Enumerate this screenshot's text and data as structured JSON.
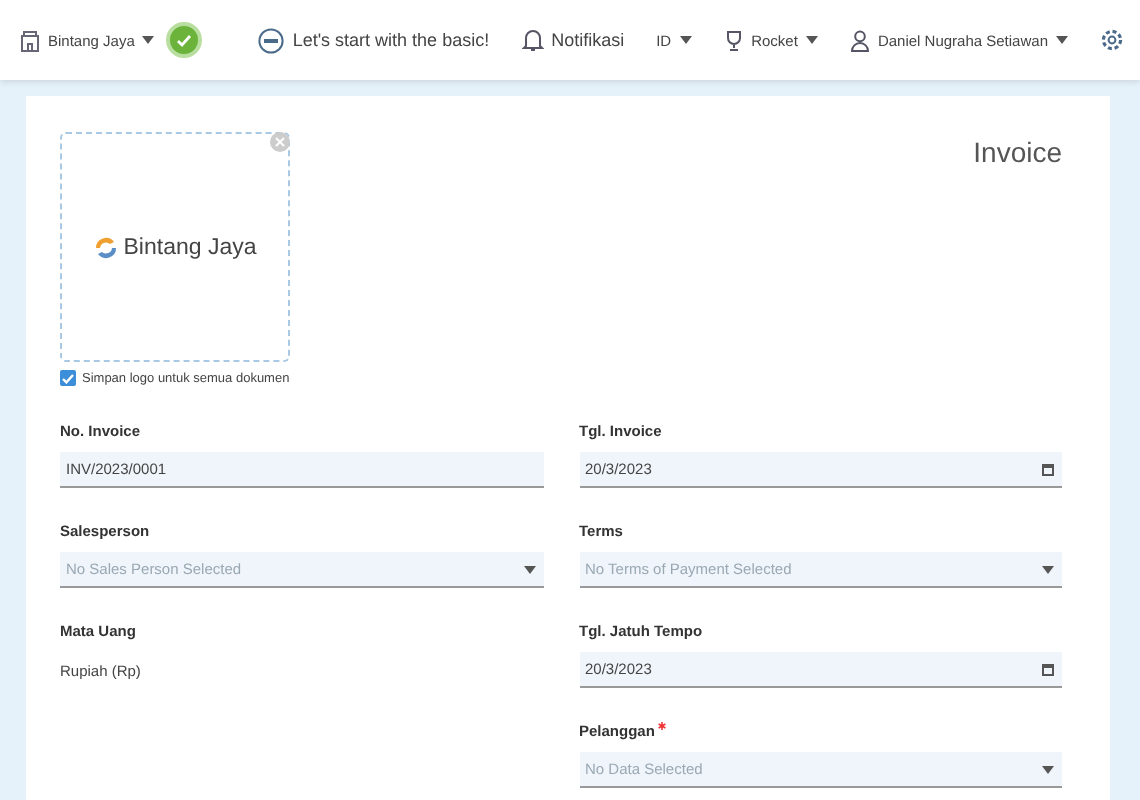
{
  "topbar": {
    "company": "Bintang Jaya",
    "verified": true,
    "guide": "Let's start with the basic!",
    "notifications": "Notifikasi",
    "language": "ID",
    "plan": "Rocket",
    "user": "Daniel Nugraha Setiawan"
  },
  "document": {
    "title": "Invoice",
    "logo_text": "Bintang Jaya",
    "save_logo": {
      "label": "Simpan logo untuk semua dokumen",
      "checked": true
    }
  },
  "left_fields": [
    {
      "kind": "text",
      "label": "No. Invoice",
      "value": "INV/2023/0001",
      "required": false
    },
    {
      "kind": "select",
      "label": "Salesperson",
      "placeholder": "No Sales Person Selected",
      "required": false
    },
    {
      "kind": "static",
      "label": "Mata Uang",
      "value": "Rupiah (Rp)",
      "required": false
    }
  ],
  "right_fields": [
    {
      "kind": "date",
      "label": "Tgl. Invoice",
      "value": "20/3/2023",
      "required": false
    },
    {
      "kind": "select",
      "label": "Terms",
      "placeholder": "No Terms of Payment Selected",
      "required": false
    },
    {
      "kind": "date",
      "label": "Tgl. Jatuh Tempo",
      "value": "20/3/2023",
      "required": false
    },
    {
      "kind": "select",
      "label": "Pelanggan",
      "placeholder": "No Data Selected",
      "required": true
    }
  ]
}
